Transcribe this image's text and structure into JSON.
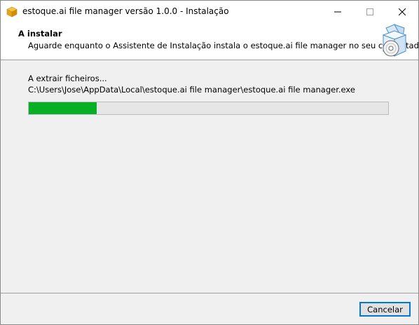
{
  "window": {
    "title": "estoque.ai file manager versão 1.0.0 - Instalação",
    "icon": "package-box-icon",
    "controls": {
      "minimize": "–",
      "maximize": "☐",
      "close": "✕"
    }
  },
  "header": {
    "title": "A instalar",
    "subtitle": "Aguarde enquanto o Assistente de Instalação instala o estoque.ai file manager no seu computador.",
    "graphic_icon": "installer-box-cd-icon"
  },
  "body": {
    "status": "A extrair ficheiros...",
    "path": "C:\\Users\\Jose\\AppData\\Local\\estoque.ai file manager\\estoque.ai file manager.exe",
    "progress_percent": 19
  },
  "footer": {
    "cancel_label": "Cancelar"
  },
  "colors": {
    "progress_fill": "#06b025",
    "progress_track": "#e6e6e6",
    "button_focus": "#0078d7",
    "dialog_bg": "#f0f0f0"
  }
}
